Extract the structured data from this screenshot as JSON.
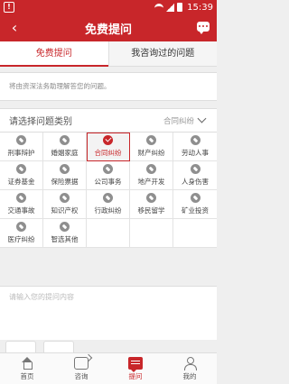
{
  "status_bar": {
    "time": "15:39"
  },
  "app_bar": {
    "title": "免费提问"
  },
  "tabs": [
    {
      "label": "免费提问",
      "active": true
    },
    {
      "label": "我咨询过的问题",
      "active": false
    }
  ],
  "intro_text": "将由资深法务助理解答您的问题。",
  "category": {
    "header_label": "请选择问题类别",
    "selected_value": "合同纠纷",
    "items": [
      {
        "label": "刑事辩护",
        "selected": false
      },
      {
        "label": "婚姻家庭",
        "selected": false
      },
      {
        "label": "合同纠纷",
        "selected": true
      },
      {
        "label": "财产纠纷",
        "selected": false
      },
      {
        "label": "劳动人事",
        "selected": false
      },
      {
        "label": "证券基金",
        "selected": false
      },
      {
        "label": "保险票据",
        "selected": false
      },
      {
        "label": "公司事务",
        "selected": false
      },
      {
        "label": "地产开发",
        "selected": false
      },
      {
        "label": "人身伤害",
        "selected": false
      },
      {
        "label": "交通事故",
        "selected": false
      },
      {
        "label": "知识产权",
        "selected": false
      },
      {
        "label": "行政纠纷",
        "selected": false
      },
      {
        "label": "移民留学",
        "selected": false
      },
      {
        "label": "矿业投资",
        "selected": false
      },
      {
        "label": "医疗纠纷",
        "selected": false
      },
      {
        "label": "智选其他",
        "selected": false
      }
    ]
  },
  "question_input": {
    "placeholder": "请输入您的提问内容"
  },
  "bottom_nav": [
    {
      "label": "首页",
      "icon": "home-icon",
      "active": false
    },
    {
      "label": "咨询",
      "icon": "phone-icon",
      "active": false
    },
    {
      "label": "提问",
      "icon": "ask-icon",
      "active": true
    },
    {
      "label": "我的",
      "icon": "user-icon",
      "active": false
    }
  ],
  "colors": {
    "brand": "#c8262a",
    "background": "#efefef"
  }
}
